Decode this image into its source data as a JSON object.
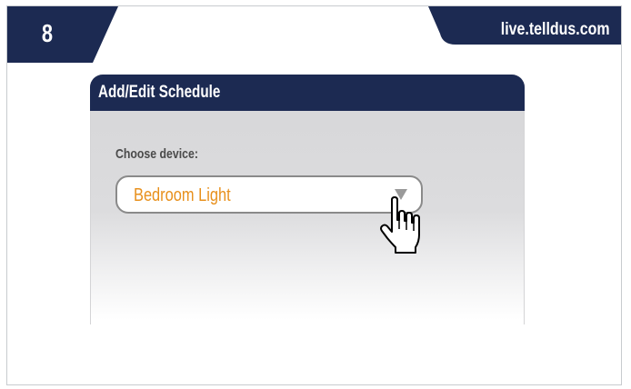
{
  "step": {
    "number": "8"
  },
  "site": {
    "label": "live.telldus.com"
  },
  "dialog": {
    "title": "Add/Edit Schedule",
    "field_label": "Choose device:",
    "select": {
      "value": "Bedroom Light"
    }
  },
  "icons": {
    "dropdown": "chevron-down-icon",
    "cursor": "hand-pointer-icon"
  },
  "colors": {
    "navy": "#1c2a52",
    "accent": "#e8901c",
    "frame_border": "#c8cbcf"
  }
}
